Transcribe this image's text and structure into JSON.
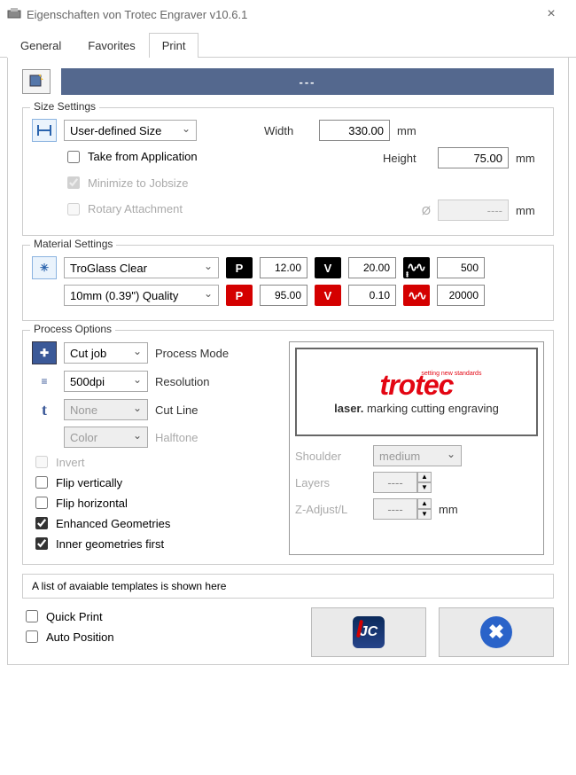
{
  "window": {
    "title": "Eigenschaften von Trotec Engraver v10.6.1"
  },
  "tabs": [
    "General",
    "Favorites",
    "Print"
  ],
  "active_tab": 2,
  "header_bar": "---",
  "size_settings": {
    "title": "Size Settings",
    "size_mode": "User-defined Size",
    "width_label": "Width",
    "width": "330.00",
    "height_label": "Height",
    "height": "75.00",
    "unit": "mm",
    "take_from_app": "Take from Application",
    "minimize": "Minimize to Jobsize",
    "rotary": "Rotary Attachment",
    "diameter_symbol": "Ø",
    "diameter_value": "----"
  },
  "material_settings": {
    "title": "Material Settings",
    "material": "TroGlass Clear",
    "quality": "10mm (0.39\") Quality",
    "row1": {
      "p": "12.00",
      "v": "20.00",
      "hz": "500"
    },
    "row2": {
      "p": "95.00",
      "v": "0.10",
      "hz": "20000"
    }
  },
  "process": {
    "title": "Process Options",
    "mode_label": "Process Mode",
    "mode": "Cut job",
    "res_label": "Resolution",
    "res": "500dpi",
    "cut_label": "Cut Line",
    "cut": "None",
    "half_label": "Halftone",
    "half": "Color",
    "invert": "Invert",
    "flip_v": "Flip vertically",
    "flip_h": "Flip horizontal",
    "enhanced": "Enhanced Geometries",
    "inner": "Inner geometries first",
    "shoulder_label": "Shoulder",
    "shoulder": "medium",
    "layers_label": "Layers",
    "layers": "----",
    "zadj_label": "Z-Adjust/L",
    "zadj": "----",
    "zunit": "mm",
    "logo_brand": "trotec",
    "logo_tag_bold": "laser.",
    "logo_tag_rest": " marking cutting engraving",
    "logo_badge": "setting new standards"
  },
  "templates_note": "A list of avaiable templates is shown here",
  "bottom": {
    "quick": "Quick Print",
    "auto": "Auto Position"
  }
}
